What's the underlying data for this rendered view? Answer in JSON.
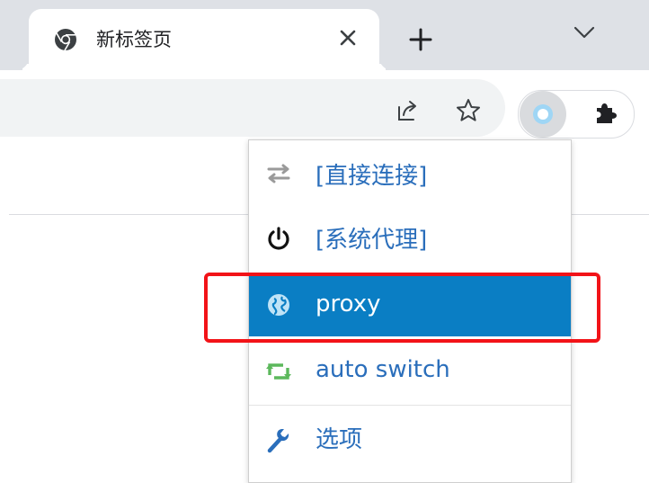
{
  "tab": {
    "title": "新标签页",
    "favicon": "chrome-icon",
    "close_icon": "close-icon"
  },
  "tabstrip": {
    "new_tab_icon": "plus-icon",
    "tab_search_icon": "chevron-down-icon"
  },
  "toolbar": {
    "share_icon": "share-icon",
    "bookmark_icon": "star-icon",
    "extension_icon": "switchyomega-icon",
    "extensions_menu_icon": "puzzle-icon"
  },
  "menu": {
    "items": [
      {
        "label": "[直接连接]",
        "icon": "swap-arrows-icon",
        "selected": false
      },
      {
        "label": "[系统代理]",
        "icon": "power-icon",
        "selected": false
      },
      {
        "label": "proxy",
        "icon": "globe-icon",
        "selected": true
      },
      {
        "label": "auto switch",
        "icon": "retweet-icon",
        "selected": false
      },
      {
        "label": "选项",
        "icon": "wrench-icon",
        "selected": false
      }
    ]
  },
  "colors": {
    "tabstrip_bg": "#dee1e6",
    "selected_item_bg": "#0a7ec4",
    "label_blue": "#2a6ebb",
    "highlight_red": "#f21318",
    "auto_switch_green": "#5cb85c"
  }
}
